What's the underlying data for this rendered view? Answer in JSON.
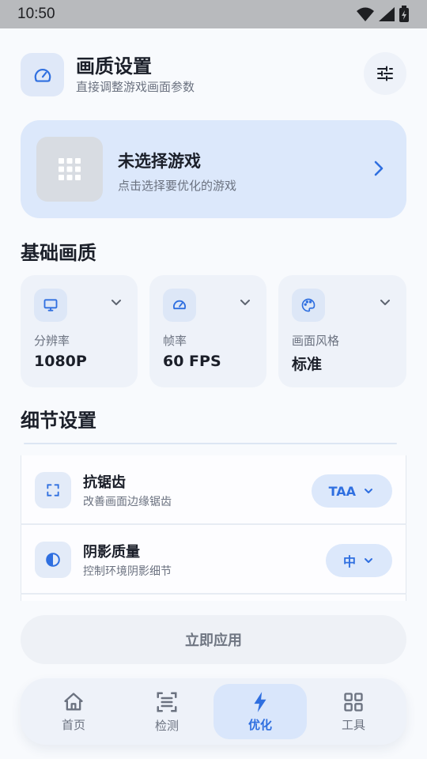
{
  "status": {
    "time": "10:50"
  },
  "header": {
    "title": "画质设置",
    "subtitle": "直接调整游戏画面参数"
  },
  "game": {
    "title": "未选择游戏",
    "subtitle": "点击选择要优化的游戏"
  },
  "sections": {
    "basic": "基础画质",
    "detail": "细节设置"
  },
  "quality_cards": [
    {
      "label": "分辨率",
      "value": "1080P",
      "icon": "monitor-icon"
    },
    {
      "label": "帧率",
      "value": "60 FPS",
      "icon": "speedometer-icon"
    },
    {
      "label": "画面风格",
      "value": "标准",
      "icon": "palette-icon"
    }
  ],
  "details": [
    {
      "title": "抗锯齿",
      "subtitle": "改善画面边缘锯齿",
      "value": "TAA",
      "icon": "frame-corners-icon"
    },
    {
      "title": "阴影质量",
      "subtitle": "控制环境阴影细节",
      "value": "中",
      "icon": "contrast-icon"
    }
  ],
  "apply_label": "立即应用",
  "nav": [
    {
      "label": "首页",
      "icon": "home-icon",
      "active": false
    },
    {
      "label": "检测",
      "icon": "scan-icon",
      "active": false
    },
    {
      "label": "优化",
      "icon": "bolt-icon",
      "active": true
    },
    {
      "label": "工具",
      "icon": "grid-icon",
      "active": false
    }
  ],
  "colors": {
    "accent": "#2f6fe0",
    "card_bg": "#dce8fb",
    "surface": "#eef2f9"
  }
}
